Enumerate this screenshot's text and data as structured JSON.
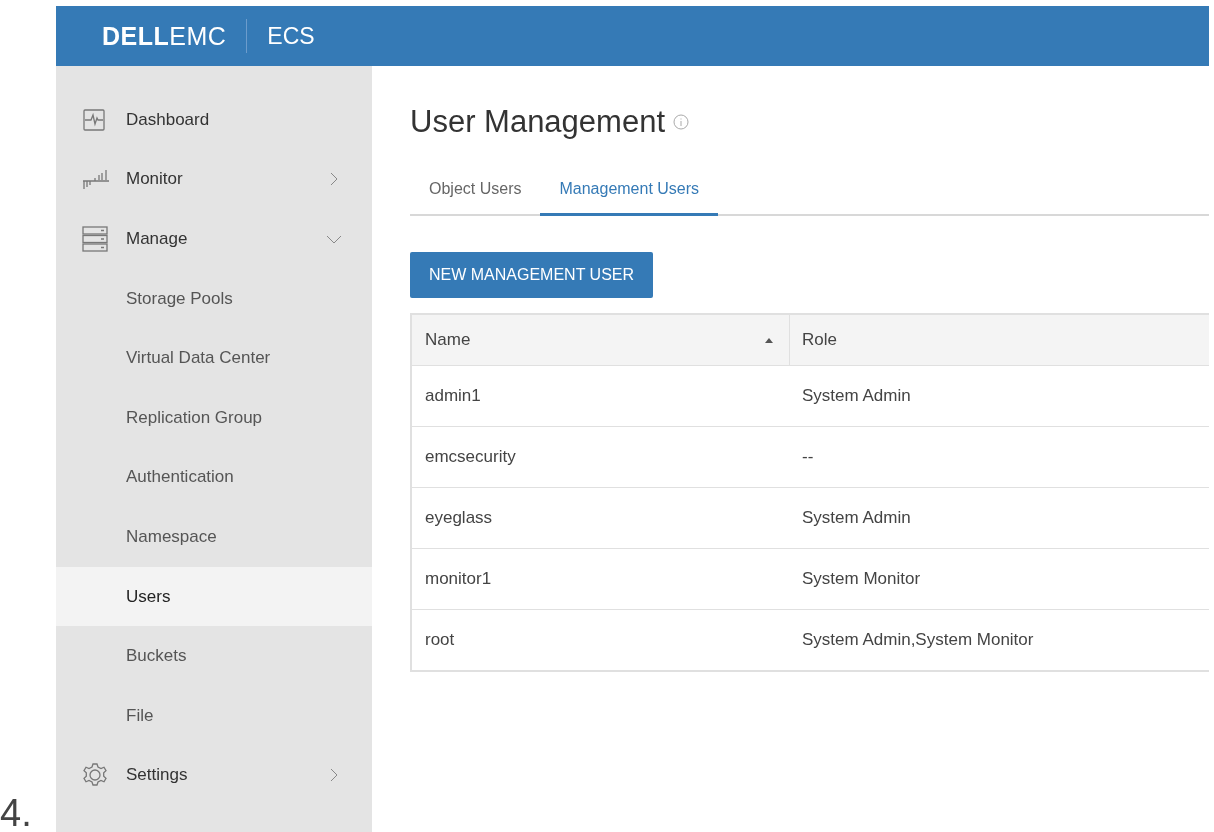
{
  "step_number": "4.",
  "header": {
    "logo_brand": "DELL",
    "logo_suffix": "EMC",
    "product": "ECS"
  },
  "sidebar": {
    "items": [
      {
        "kind": "link",
        "label": "Dashboard",
        "selected": false
      },
      {
        "kind": "group",
        "label": "Monitor",
        "expanded": false,
        "selected": false
      },
      {
        "kind": "group",
        "label": "Manage",
        "expanded": true,
        "selected": false
      },
      {
        "kind": "sub",
        "label": "Storage Pools",
        "selected": false
      },
      {
        "kind": "sub",
        "label": "Virtual Data Center",
        "selected": false
      },
      {
        "kind": "sub",
        "label": "Replication Group",
        "selected": false
      },
      {
        "kind": "sub",
        "label": "Authentication",
        "selected": false
      },
      {
        "kind": "sub",
        "label": "Namespace",
        "selected": false
      },
      {
        "kind": "sub",
        "label": "Users",
        "selected": true
      },
      {
        "kind": "sub",
        "label": "Buckets",
        "selected": false
      },
      {
        "kind": "sub",
        "label": "File",
        "selected": false
      },
      {
        "kind": "group",
        "label": "Settings",
        "expanded": false,
        "selected": false
      }
    ]
  },
  "page": {
    "title": "User Management",
    "tabs": [
      {
        "label": "Object Users",
        "selected": false
      },
      {
        "label": "Management Users",
        "selected": true
      }
    ],
    "button": "NEW MANAGEMENT USER",
    "table": {
      "columns": [
        {
          "label": "Name",
          "sorted": true
        },
        {
          "label": "Role",
          "sorted": false
        }
      ],
      "rows": [
        {
          "name": "admin1",
          "role": "System Admin"
        },
        {
          "name": "emcsecurity",
          "role": "--"
        },
        {
          "name": "eyeglass",
          "role": "System Admin"
        },
        {
          "name": "monitor1",
          "role": "System Monitor"
        },
        {
          "name": "root",
          "role": "System Admin,System Monitor"
        }
      ]
    }
  }
}
